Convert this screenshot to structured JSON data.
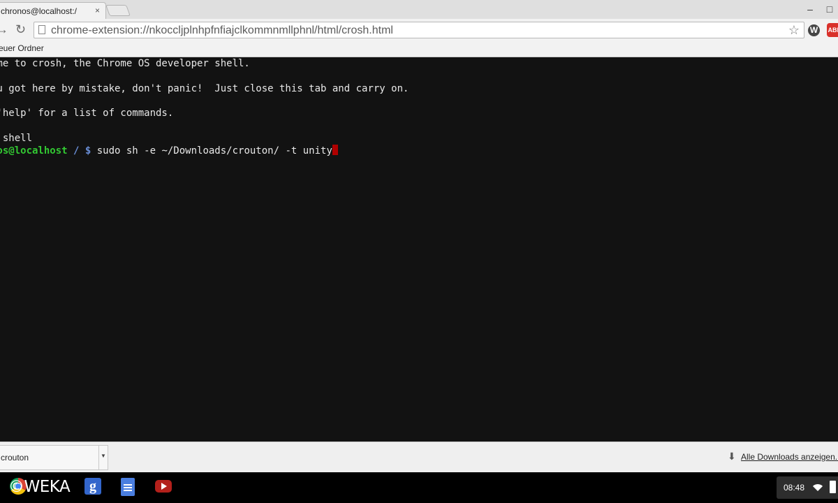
{
  "window": {
    "tab_title": "chronos@localhost:/",
    "tab_close": "×",
    "minimize": "–",
    "maximize": "□"
  },
  "toolbar": {
    "forward": "→",
    "reload": "↻",
    "url": "chrome-extension://nkoccljplnhpfnfiajclkommnmllphnl/html/crosh.html",
    "star": "☆",
    "ext_wordpress": "W",
    "ext_adblock": "ABP"
  },
  "bookmarks": {
    "folder_label": "euer Ordner"
  },
  "terminal": {
    "lines": [
      "ome to crosh, the Chrome OS developer shell.",
      "ou got here by mistake, don't panic!  Just close this tab and carry on.",
      " 'help' for a list of commands.",
      "> shell"
    ],
    "prompt_user": "nos@localhost",
    "prompt_path": " / $",
    "command": " sudo sh -e ~/Downloads/crouton/ -t unity"
  },
  "download_shelf": {
    "item_name": "crouton",
    "item_arrow": "▼",
    "download_icon": "⬇",
    "show_all": "Alle Downloads anzeigen..."
  },
  "taskbar": {
    "watermark": "©WEKA",
    "gplus_label": "g",
    "clock": "08:48"
  }
}
